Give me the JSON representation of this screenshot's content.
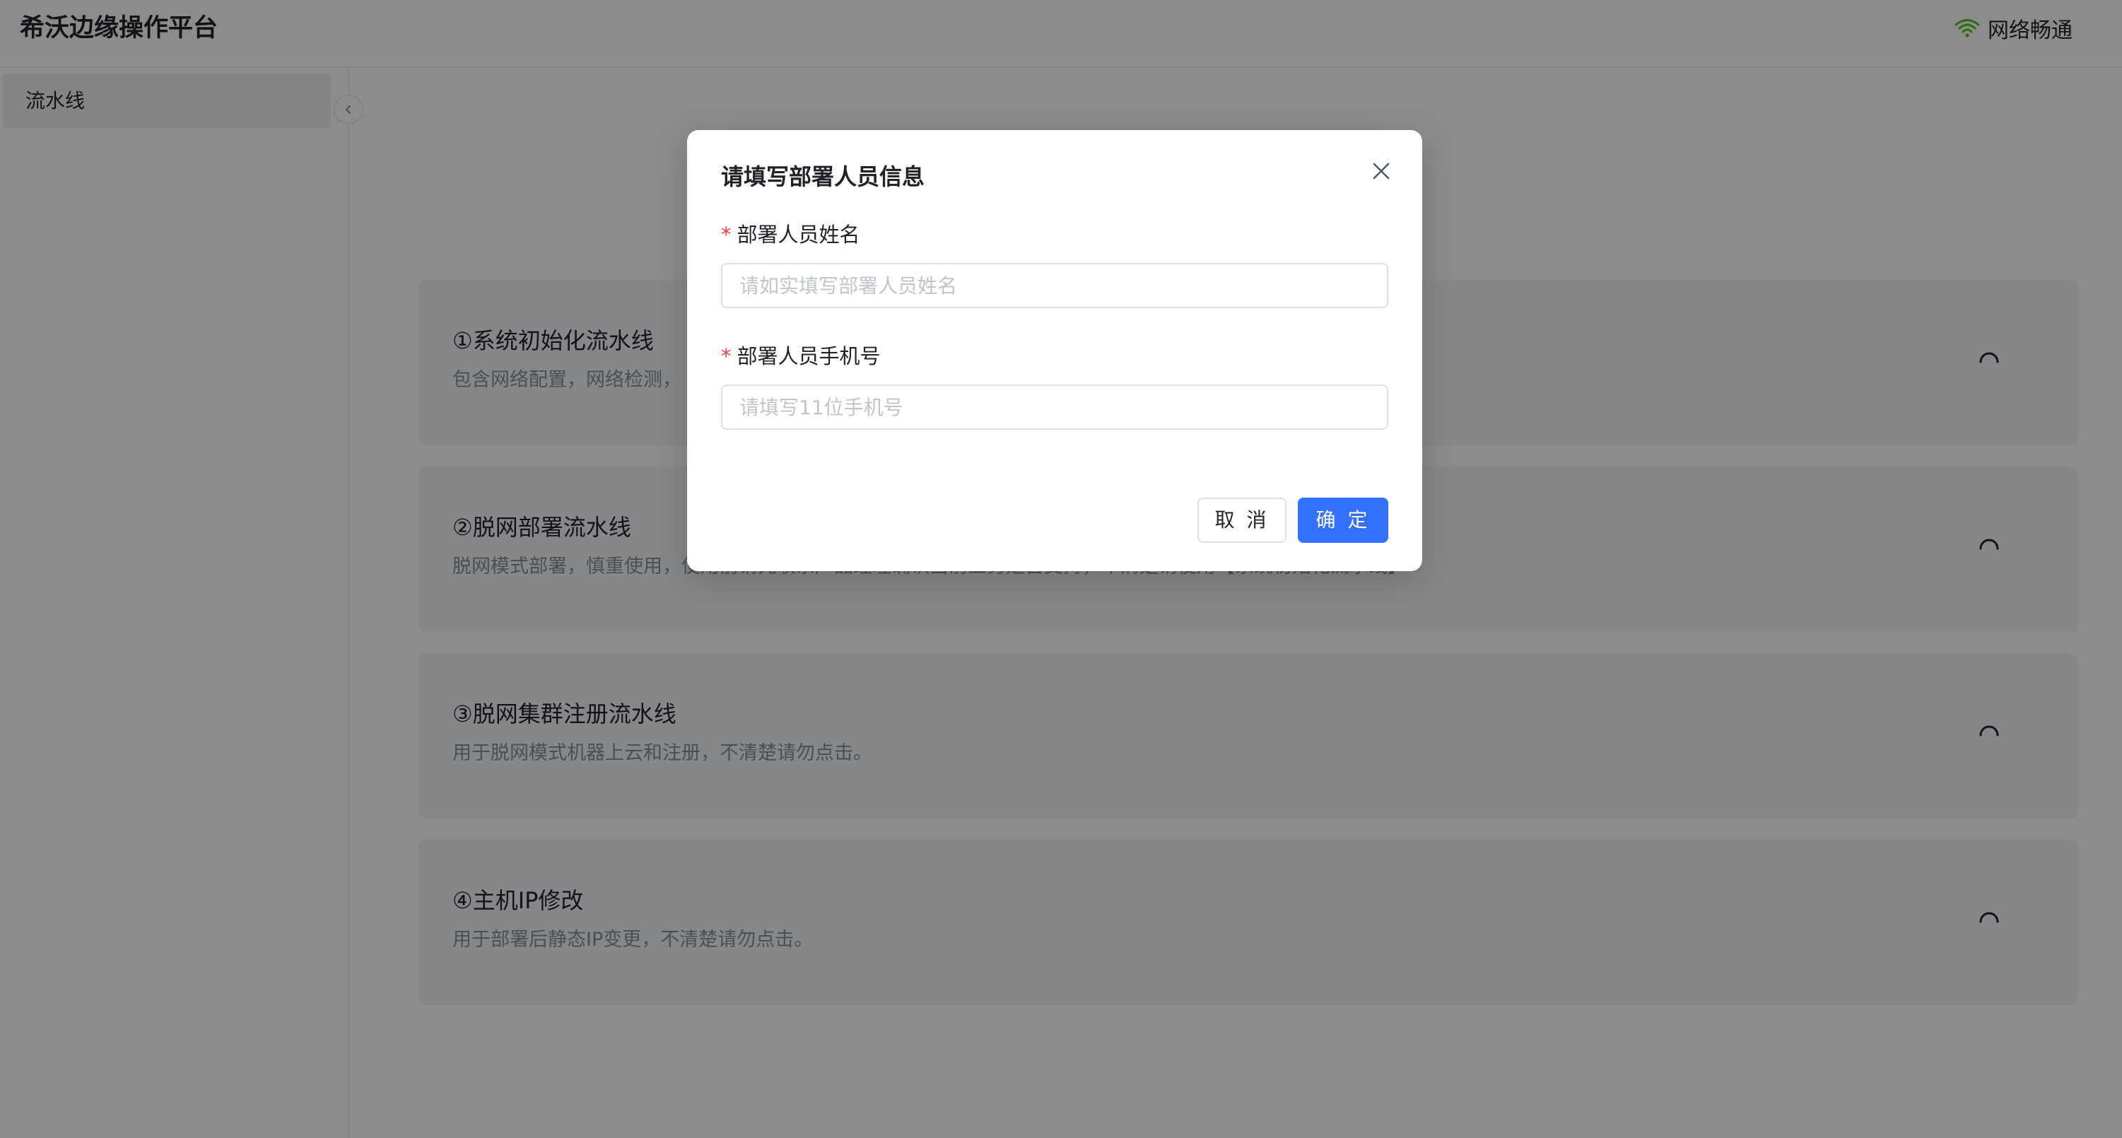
{
  "header": {
    "app_title": "希沃边缘操作平台",
    "network_status": "网络畅通",
    "network_icon": "wifi-icon"
  },
  "sidebar": {
    "items": [
      {
        "label": "流水线"
      }
    ],
    "collapse_icon": "chevron-left-icon"
  },
  "pipelines": [
    {
      "title": "①系统初始化流水线",
      "description": "包含网络配置，网络检测，"
    },
    {
      "title": "②脱网部署流水线",
      "description": "脱网模式部署，慎重使用，使用前请先联系产品经理确认当前业务是否支持，不清楚请使用【系统初始化流水线】"
    },
    {
      "title": "③脱网集群注册流水线",
      "description": "用于脱网模式机器上云和注册，不清楚请勿点击。"
    },
    {
      "title": "④主机IP修改",
      "description": "用于部署后静态IP变更，不清楚请勿点击。"
    }
  ],
  "modal": {
    "title": "请填写部署人员信息",
    "fields": [
      {
        "required_mark": "*",
        "label": "部署人员姓名",
        "value": "",
        "placeholder": "请如实填写部署人员姓名"
      },
      {
        "required_mark": "*",
        "label": "部署人员手机号",
        "value": "",
        "placeholder": "请填写11位手机号"
      }
    ],
    "cancel_label": "取 消",
    "confirm_label": "确 定"
  },
  "colors": {
    "primary": "#3370ff",
    "required": "#f53f3f",
    "network_ok": "#52c41a",
    "overlay": "rgba(0,0,0,0.45)"
  }
}
